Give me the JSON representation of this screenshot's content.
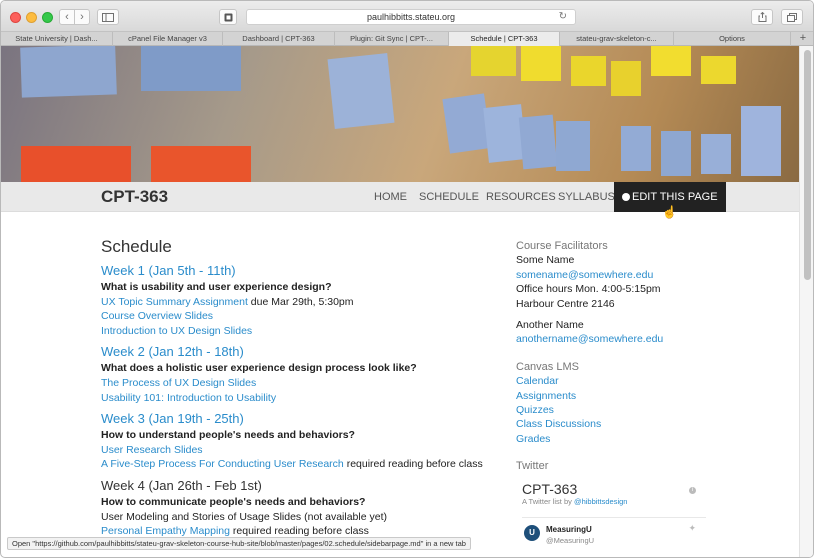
{
  "browser": {
    "address": "paulhibbitts.stateu.org",
    "tabs": [
      {
        "label": "State University | Dash...",
        "active": false
      },
      {
        "label": "cPanel File Manager v3",
        "active": false
      },
      {
        "label": "Dashboard | CPT-363",
        "active": false
      },
      {
        "label": "Plugin: Git Sync | CPT-...",
        "active": false
      },
      {
        "label": "Schedule | CPT-363",
        "active": true
      },
      {
        "label": "stateu-grav-skeleton-c...",
        "active": false
      },
      {
        "label": "Options",
        "active": false
      }
    ],
    "status_text": "Open \"https://github.com/paulhibbitts/stateu-grav-skeleton-course-hub-site/blob/master/pages/02.schedule/sidebarpage.md\" in a new tab"
  },
  "site": {
    "title": "CPT-363",
    "nav": {
      "home": "HOME",
      "schedule": "SCHEDULE",
      "resources": "RESOURCES",
      "syllabus": "SYLLABUS",
      "edit": "EDIT THIS PAGE"
    }
  },
  "main": {
    "page_title": "Schedule",
    "weeks": [
      {
        "title": "Week 1 (Jan 5th - 11th)",
        "question": "What is usability and user experience design?",
        "items": [
          {
            "link": "UX Topic Summary Assignment",
            "suffix": " due Mar 29th, 5:30pm"
          },
          {
            "link": "Course Overview Slides",
            "suffix": ""
          },
          {
            "link": "Introduction to UX Design Slides",
            "suffix": ""
          }
        ]
      },
      {
        "title": "Week 2 (Jan 12th - 18th)",
        "question": "What does a holistic user experience design process look like?",
        "items": [
          {
            "link": "The Process of UX Design Slides",
            "suffix": ""
          },
          {
            "link": "Usability 101: Introduction to Usability",
            "suffix": ""
          }
        ]
      },
      {
        "title": "Week 3 (Jan 19th - 25th)",
        "question": "How to understand people's needs and behaviors?",
        "items": [
          {
            "link": "User Research Slides",
            "suffix": ""
          },
          {
            "link": "A Five-Step Process For Conducting User Research",
            "suffix": " required reading before class"
          }
        ]
      },
      {
        "title": "Week 4 (Jan 26th - Feb 1st)",
        "question": "How to communicate people's needs and behaviors?",
        "items": [
          {
            "text": "User Modeling and Stories of Usage Slides (not available yet)"
          },
          {
            "link": "Personal Empathy Mapping",
            "suffix": " required reading before class"
          }
        ]
      }
    ]
  },
  "aside": {
    "facilitators_heading": "Course Facilitators",
    "facilitator1": {
      "name": "Some Name",
      "email": "somename@somewhere.edu",
      "hours": "Office hours Mon. 4:00-5:15pm",
      "location": "Harbour Centre 2146"
    },
    "facilitator2": {
      "name": "Another Name",
      "email": "anothername@somewhere.edu"
    },
    "lms_heading": "Canvas LMS",
    "lms_links": [
      "Calendar",
      "Assignments",
      "Quizzes",
      "Class Discussions",
      "Grades"
    ],
    "twitter_heading": "Twitter"
  },
  "twitter": {
    "list_title": "CPT-363",
    "list_by_prefix": "A Twitter list by ",
    "list_by_user": "@hibbittsdesign",
    "tweet_name": "MeasuringU",
    "tweet_handle": "@MeasuringU",
    "avatar_letter": "U"
  }
}
